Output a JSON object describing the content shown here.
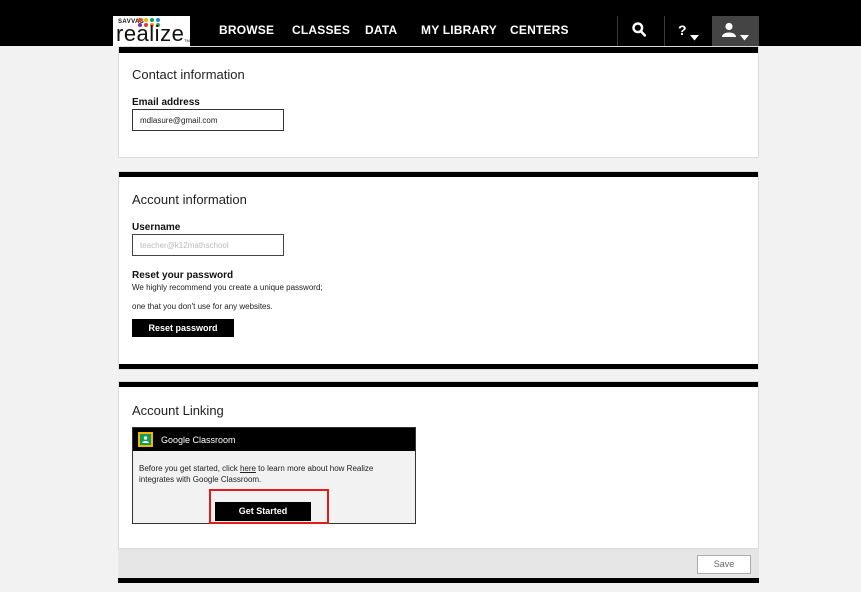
{
  "header": {
    "logo": {
      "brand_small": "SAVVAS",
      "wordmark": "realize",
      "tm": "TM"
    },
    "nav": [
      "BROWSE",
      "CLASSES",
      "DATA",
      "MY LIBRARY",
      "CENTERS"
    ],
    "help_label": "?",
    "colors": {
      "bar": "#000000",
      "user_box": "#444444"
    }
  },
  "contact": {
    "title": "Contact information",
    "email_label": "Email address",
    "email_value": "mdlasure@gmail.com"
  },
  "account": {
    "title": "Account information",
    "username_label": "Username",
    "username_value": "teacher@k12mathschool",
    "reset_title": "Reset your password",
    "reset_text_1": "We highly recommend you create a unique password;",
    "reset_text_2": "one that you don't use for any websites.",
    "reset_button": "Reset password"
  },
  "linking": {
    "title": "Account Linking",
    "provider": "Google Classroom",
    "text_before": "Before you get started, click ",
    "link_text": "here",
    "text_after": " to learn more about how Realize integrates with Google Classroom.",
    "start_button": "Get Started",
    "highlight_color": "#e41b1b"
  },
  "footer": {
    "save_label": "Save"
  },
  "icons": [
    "search-icon",
    "help-icon",
    "caret-down-icon",
    "user-icon",
    "google-classroom-icon"
  ]
}
